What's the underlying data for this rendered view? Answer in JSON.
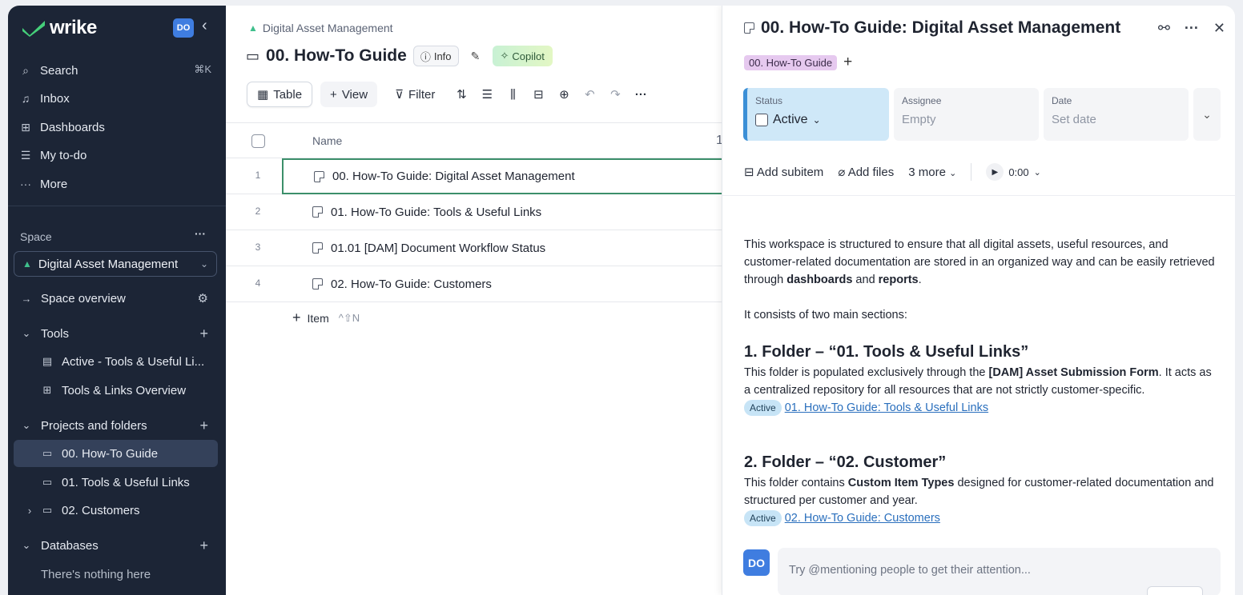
{
  "sidebar": {
    "logo": "wrike",
    "user_initials": "DO",
    "nav": [
      {
        "label": "Search",
        "icon": "search-icon"
      },
      {
        "label": "Inbox",
        "icon": "bell-icon"
      },
      {
        "label": "Dashboards",
        "icon": "dashboard-icon"
      },
      {
        "label": "My to-do",
        "icon": "todo-icon"
      },
      {
        "label": "More",
        "icon": "more-icon"
      }
    ],
    "search_shortcut": "⌘K",
    "space_label": "Space",
    "space_name": "Digital Asset Management",
    "space_overview": "Space overview",
    "tools_label": "Tools",
    "tools_items": [
      "Active - Tools & Useful Li...",
      "Tools & Links Overview"
    ],
    "projects_label": "Projects and folders",
    "projects_items": [
      "00. How-To Guide",
      "01. Tools & Useful Links",
      "02. Customers"
    ],
    "databases_label": "Databases",
    "databases_empty": "There's nothing here"
  },
  "main": {
    "breadcrumb": "Digital Asset Management",
    "title": "00. How-To Guide",
    "info_label": "Info",
    "copilot_label": "Copilot",
    "table_label": "Table",
    "view_label": "View",
    "filter_label": "Filter",
    "column_name": "Name",
    "column_partial": "1",
    "rows": [
      {
        "num": "1",
        "name": "00. How-To Guide: Digital Asset Management"
      },
      {
        "num": "2",
        "name": "01. How-To Guide: Tools & Useful Links"
      },
      {
        "num": "3",
        "name": "01.01 [DAM] Document Workflow Status"
      },
      {
        "num": "4",
        "name": "02. How-To Guide: Customers"
      }
    ],
    "add_item_label": "Item",
    "add_item_shortcut": "^⇧N"
  },
  "detail": {
    "title": "00. How-To Guide: Digital Asset Management",
    "tag": "00. How-To Guide",
    "status_label": "Status",
    "status_value": "Active",
    "assignee_label": "Assignee",
    "assignee_value": "Empty",
    "date_label": "Date",
    "date_value": "Set date",
    "add_subitem": "Add subitem",
    "add_files": "Add files",
    "more": "3 more",
    "timer": "0:00",
    "intro_1": "This workspace is structured to ensure that all digital assets, useful resources, and customer-related documentation are stored in an organized way and can be easily retrieved through ",
    "intro_bold_1": "dashboards",
    "intro_and": " and ",
    "intro_bold_2": "reports",
    "intro_end": ".",
    "consists": "It consists of two main sections:",
    "h1": "1. Folder – “01. Tools & Useful Links”",
    "p1_a": "This folder is populated exclusively through the ",
    "p1_bold": "[DAM] Asset Submission Form",
    "p1_b": ". It acts as a centralized repository for all resources that are not strictly customer-specific.",
    "chip_active": "Active",
    "link1": "01. How-To Guide: Tools & Useful Links",
    "h2": "2. Folder – “02. Customer”",
    "p2_a": " This folder contains ",
    "p2_bold": "Custom Item Types",
    "p2_b": " designed for customer-related documentation and structured per customer and year.",
    "link2": "02. How-To Guide: Customers",
    "comment_initials": "DO",
    "comment_placeholder": "Try @mentioning people to get their attention..."
  }
}
